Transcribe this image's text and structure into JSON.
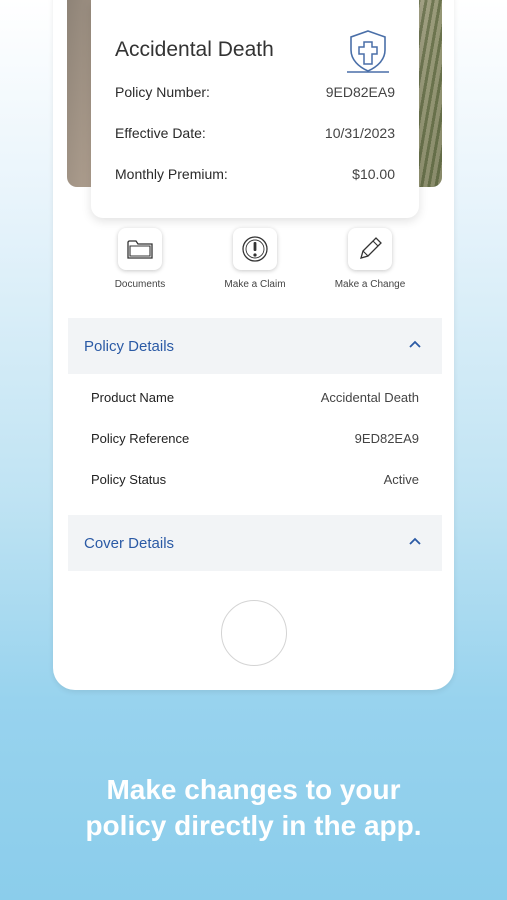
{
  "policy_card": {
    "title": "Accidental Death",
    "rows": [
      {
        "label": "Policy Number:",
        "value": "9ED82EA9"
      },
      {
        "label": "Effective Date:",
        "value": "10/31/2023"
      },
      {
        "label": "Monthly Premium:",
        "value": "$10.00"
      }
    ],
    "icon": "shield-cross-icon"
  },
  "actions": [
    {
      "label": "Documents",
      "icon": "folder-icon"
    },
    {
      "label": "Make a Claim",
      "icon": "alert-icon"
    },
    {
      "label": "Make a Change",
      "icon": "pencil-icon"
    }
  ],
  "policy_details": {
    "title": "Policy Details",
    "rows": [
      {
        "label": "Product Name",
        "value": "Accidental Death"
      },
      {
        "label": "Policy Reference",
        "value": "9ED82EA9"
      },
      {
        "label": "Policy Status",
        "value": "Active"
      }
    ]
  },
  "cover_details": {
    "title": "Cover Details"
  },
  "caption": {
    "line1": "Make changes to your",
    "line2": "policy directly in the app."
  },
  "colors": {
    "accent": "#2b5aa5",
    "icon_stroke": "#4a6fa8",
    "section_bg": "#f2f4f6"
  }
}
